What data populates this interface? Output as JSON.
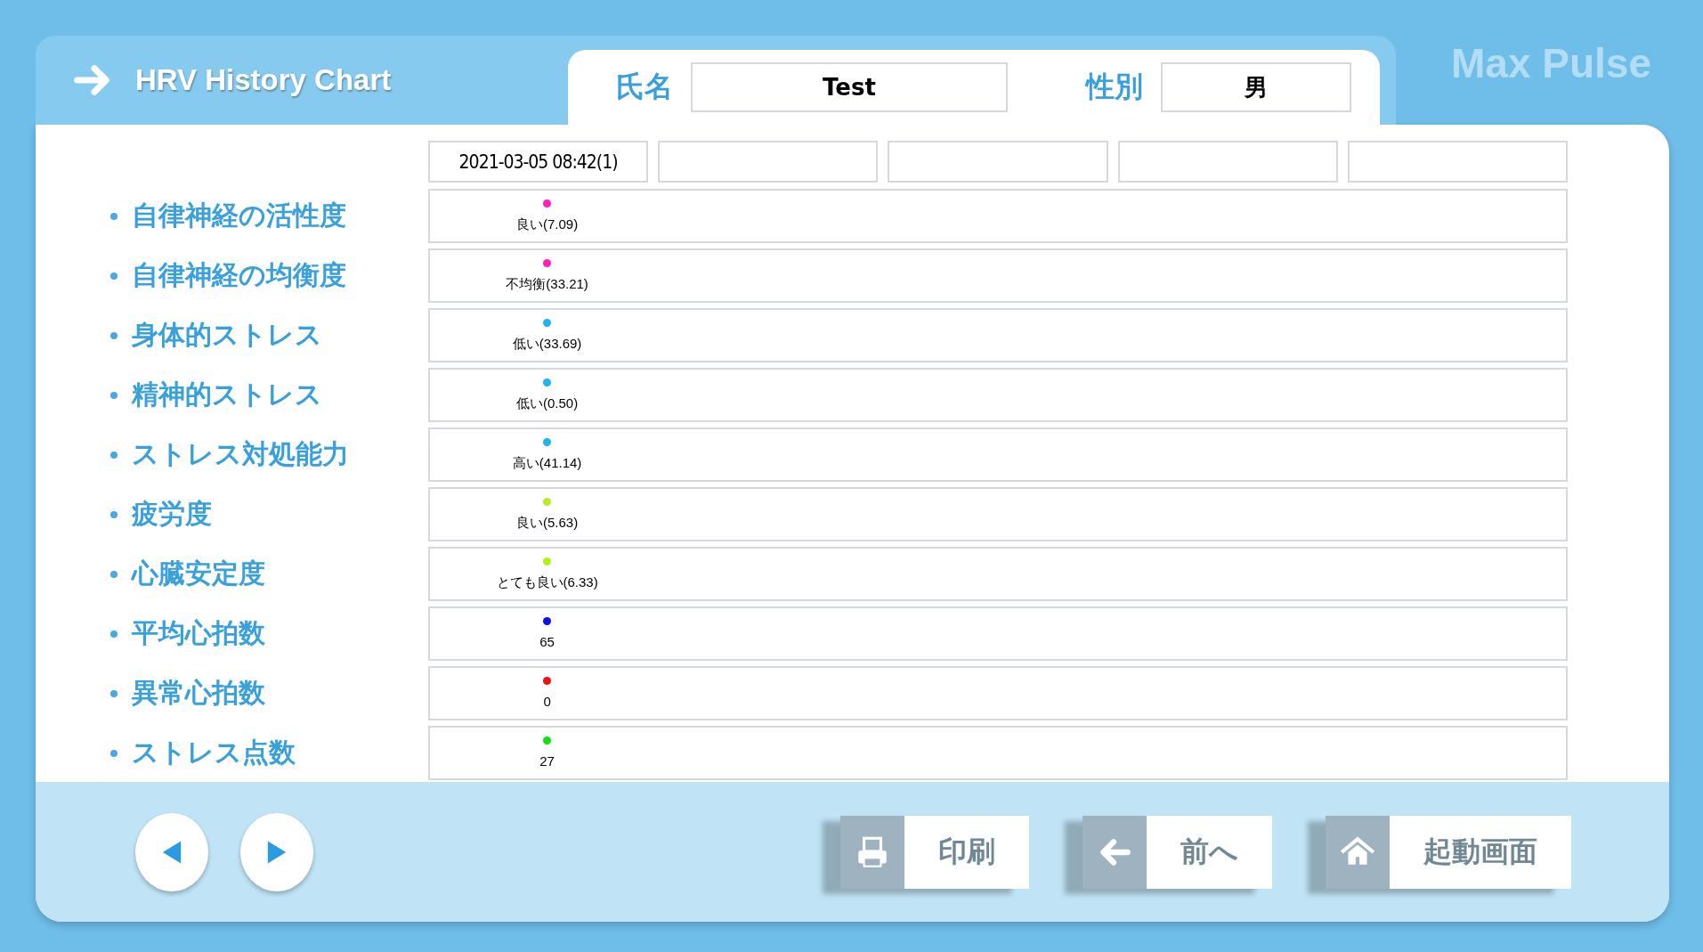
{
  "header": {
    "title": "HRV History Chart",
    "brand": "Max Pulse"
  },
  "patient": {
    "name_label": "氏名",
    "name": "Test",
    "gender_label": "性別",
    "gender": "男"
  },
  "dates": [
    "2021-03-05 08:42(1)"
  ],
  "rows": [
    {
      "label": "自律神経の活性度",
      "readings": [
        {
          "text": "良い(7.09)",
          "color": "#ff1fbf"
        }
      ]
    },
    {
      "label": "自律神経の均衡度",
      "readings": [
        {
          "text": "不均衡(33.21)",
          "color": "#ff1fbf"
        }
      ]
    },
    {
      "label": "身体的ストレス",
      "readings": [
        {
          "text": "低い(33.69)",
          "color": "#1eb4f0"
        }
      ]
    },
    {
      "label": "精神的ストレス",
      "readings": [
        {
          "text": "低い(0.50)",
          "color": "#1eb4f0"
        }
      ]
    },
    {
      "label": "ストレス対処能力",
      "readings": [
        {
          "text": "高い(41.14)",
          "color": "#1eb4f0"
        }
      ]
    },
    {
      "label": "疲労度",
      "readings": [
        {
          "text": "良い(5.63)",
          "color": "#b4f020"
        }
      ]
    },
    {
      "label": "心臓安定度",
      "readings": [
        {
          "text": "とても良い(6.33)",
          "color": "#b4f020"
        }
      ]
    },
    {
      "label": "平均心拍数",
      "readings": [
        {
          "text": "65",
          "color": "#1010e0"
        }
      ]
    },
    {
      "label": "異常心拍数",
      "readings": [
        {
          "text": "0",
          "color": "#f01010"
        }
      ]
    },
    {
      "label": "ストレス点数",
      "readings": [
        {
          "text": "27",
          "color": "#10e010"
        }
      ]
    }
  ],
  "actions": [
    {
      "kind": "print",
      "label": "印刷"
    },
    {
      "kind": "back",
      "label": "前へ"
    },
    {
      "kind": "home",
      "label": "起動画面"
    }
  ]
}
